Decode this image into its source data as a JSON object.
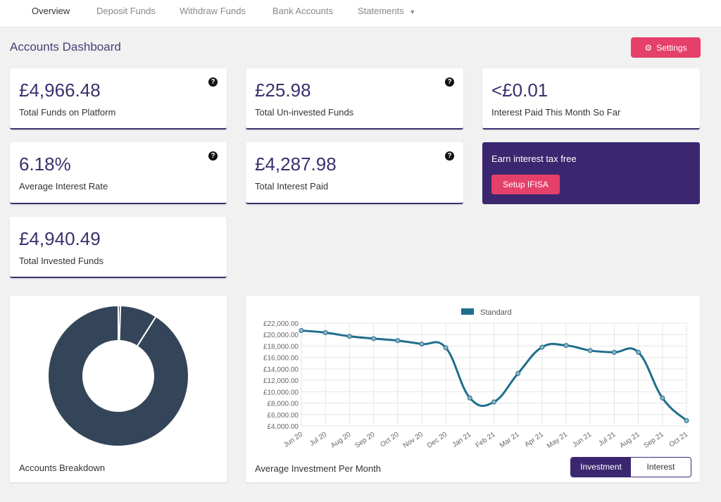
{
  "nav": {
    "items": [
      "Overview",
      "Deposit Funds",
      "Withdraw Funds",
      "Bank Accounts",
      "Statements"
    ],
    "active": "Overview"
  },
  "header": {
    "title": "Accounts Dashboard",
    "settings_label": "Settings"
  },
  "cards": [
    {
      "value": "£4,966.48",
      "label": "Total Funds on Platform",
      "help": true
    },
    {
      "value": "£25.98",
      "label": "Total Un-invested Funds",
      "help": true
    },
    {
      "value": "<£0.01",
      "label": "Interest Paid This Month So Far",
      "help": false
    },
    {
      "value": "6.18%",
      "label": "Average Interest Rate",
      "help": true
    },
    {
      "value": "£4,287.98",
      "label": "Total Interest Paid",
      "help": true
    },
    {
      "value": "£4,940.49",
      "label": "Total Invested Funds",
      "help": false
    }
  ],
  "promo": {
    "text": "Earn interest tax free",
    "button": "Setup IFISA"
  },
  "colors": {
    "brand": "#3a2770",
    "accent": "#e5406a",
    "line": "#1e6e8c",
    "donut": "#34455a"
  },
  "chart_data": [
    {
      "type": "pie",
      "title": "Accounts Breakdown",
      "values_percent": [
        0.5,
        8.5,
        91.0
      ]
    },
    {
      "type": "line",
      "title": "Average Investment Per Month",
      "categories": [
        "Jun 20",
        "Jul 20",
        "Aug 20",
        "Sep 20",
        "Oct 20",
        "Nov 20",
        "Dec 20",
        "Jan 21",
        "Feb 21",
        "Mar 21",
        "Apr 21",
        "May 21",
        "Jun 21",
        "Jul 21",
        "Aug 21",
        "Sep 21",
        "Oct 21"
      ],
      "series": [
        {
          "name": "Standard",
          "values": [
            20700,
            20350,
            19700,
            19300,
            18950,
            18350,
            17700,
            8900,
            8200,
            13200,
            17800,
            18100,
            17200,
            16900,
            16900,
            8900,
            4940
          ]
        }
      ],
      "yticks": [
        "£4,000.00",
        "£6,000.00",
        "£8,000.00",
        "£10,000.00",
        "£12,000.00",
        "£14,000.00",
        "£16,000.00",
        "£18,000.00",
        "£20,000.00",
        "£22,000.00"
      ],
      "ylim": [
        4000,
        22000
      ],
      "legend": "top",
      "grid": true
    }
  ],
  "toggle": {
    "options": [
      "Investment",
      "Interest"
    ],
    "selected": "Investment"
  }
}
